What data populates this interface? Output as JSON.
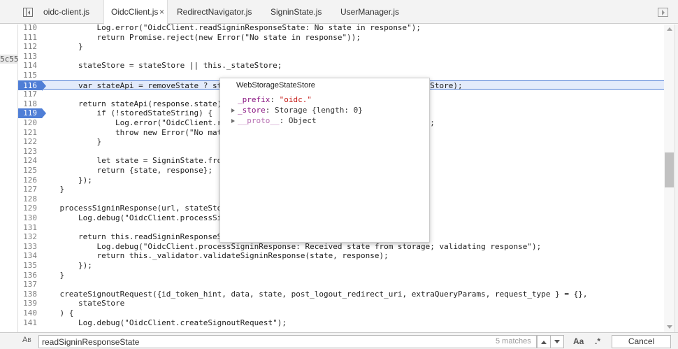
{
  "tabs": [
    {
      "label": "oidc-client.js",
      "active": false
    },
    {
      "label": "OidcClient.js",
      "active": true,
      "close": "×"
    },
    {
      "label": "RedirectNavigator.js",
      "active": false
    },
    {
      "label": "SigninState.js",
      "active": false
    },
    {
      "label": "UserManager.js",
      "active": false
    }
  ],
  "left_gutter": {
    "hash": "5c55"
  },
  "code": {
    "lines": [
      {
        "n": "110",
        "t": "            Log.error(\"OidcClient.readSigninResponseState: No state in response\");"
      },
      {
        "n": "111",
        "t": "            return Promise.reject(new Error(\"No state in response\"));"
      },
      {
        "n": "112",
        "t": "        }"
      },
      {
        "n": "113",
        "t": ""
      },
      {
        "n": "114",
        "t": "        stateStore = stateStore || this._stateStore;"
      },
      {
        "n": "115",
        "t": ""
      },
      {
        "n": "116",
        "t": "        var stateApi = removeState ? st                              .get.bind(stateStore);"
      },
      {
        "n": "117",
        "t": ""
      },
      {
        "n": "118",
        "t": "        return stateApi(response.state)"
      },
      {
        "n": "119",
        "t": "            if (!storedStateString) {"
      },
      {
        "n": "120",
        "t": "                Log.error(\"OidcClient.r                              nd in storage\");"
      },
      {
        "n": "121",
        "t": "                throw new Error(\"No mat"
      },
      {
        "n": "122",
        "t": "            }"
      },
      {
        "n": "123",
        "t": ""
      },
      {
        "n": "124",
        "t": "            let state = SigninState.fro"
      },
      {
        "n": "125",
        "t": "            return {state, response};"
      },
      {
        "n": "126",
        "t": "        });"
      },
      {
        "n": "127",
        "t": "    }"
      },
      {
        "n": "128",
        "t": ""
      },
      {
        "n": "129",
        "t": "    processSigninResponse(url, stateSto"
      },
      {
        "n": "130",
        "t": "        Log.debug(\"OidcClient.processSi"
      },
      {
        "n": "131",
        "t": ""
      },
      {
        "n": "132",
        "t": "        return this.readSigninResponseS                              ponse}) => {"
      },
      {
        "n": "133",
        "t": "            Log.debug(\"OidcClient.processSigninResponse: Received state from storage; validating response\");"
      },
      {
        "n": "134",
        "t": "            return this._validator.validateSigninResponse(state, response);"
      },
      {
        "n": "135",
        "t": "        });"
      },
      {
        "n": "136",
        "t": "    }"
      },
      {
        "n": "137",
        "t": ""
      },
      {
        "n": "138",
        "t": "    createSignoutRequest({id_token_hint, data, state, post_logout_redirect_uri, extraQueryParams, request_type } = {},"
      },
      {
        "n": "139",
        "t": "        stateStore"
      },
      {
        "n": "140",
        "t": "    ) {"
      },
      {
        "n": "141",
        "t": "        Log.debug(\"OidcClient.createSignoutRequest\");"
      }
    ]
  },
  "popover": {
    "title": "WebStorageStateStore",
    "rows": [
      {
        "name": "_prefix",
        "value": "\"oidc.\"",
        "expandable": false
      },
      {
        "name": "_store",
        "value": "Storage {length: 0}",
        "expandable": true
      },
      {
        "name": "__proto__",
        "value": "Object",
        "expandable": true
      }
    ]
  },
  "search": {
    "replace_toggle": "A",
    "replace_toggle_sub": "B",
    "query": "readSigninResponseState",
    "matches": "5 matches",
    "case_label": "Aa",
    "regex_label": ".*",
    "cancel_label": "Cancel"
  },
  "colors": {
    "breakpoint": "#4f7ed6",
    "exec_line": "#e3ebfb",
    "string": "#c41a16",
    "keyword": "#aa0d91",
    "property": "#881280"
  }
}
